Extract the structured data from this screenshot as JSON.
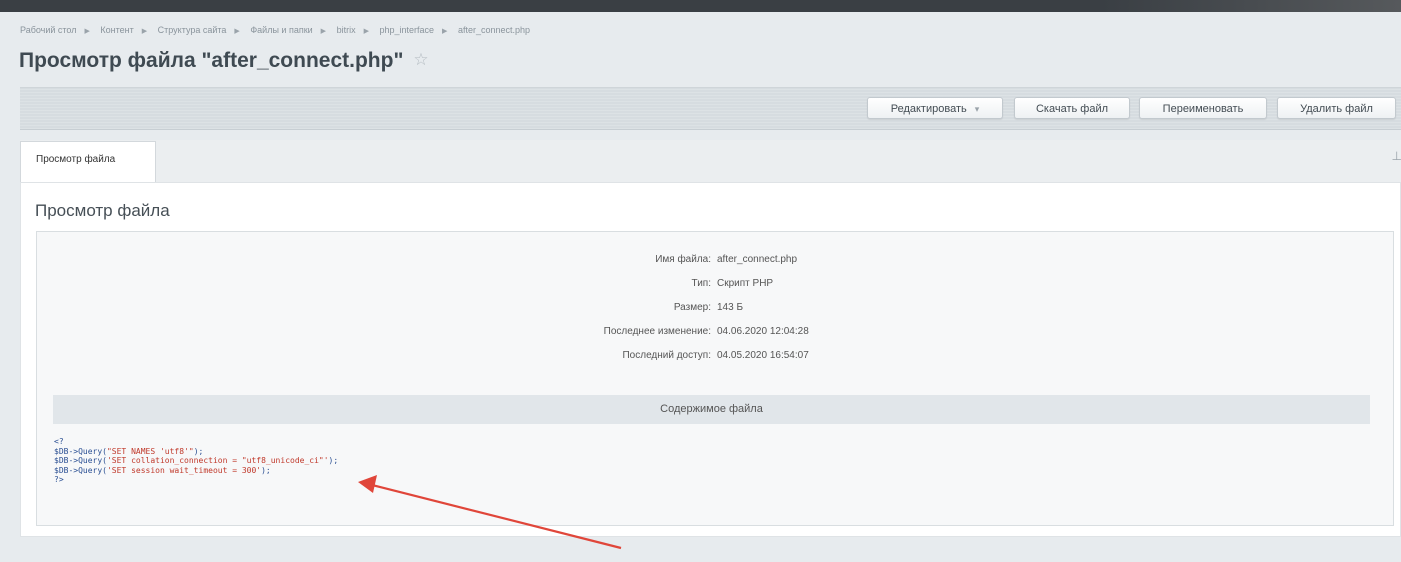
{
  "breadcrumb": [
    "Рабочий стол",
    "Контент",
    "Структура сайта",
    "Файлы и папки",
    "bitrix",
    "php_interface",
    "after_connect.php"
  ],
  "page_title": "Просмотр файла \"after_connect.php\"",
  "toolbar": {
    "edit": "Редактировать",
    "download": "Скачать файл",
    "rename": "Переименовать",
    "delete": "Удалить файл"
  },
  "tab": "Просмотр файла",
  "section_title": "Просмотр файла",
  "props": [
    {
      "label": "Имя файла:",
      "value": "after_connect.php"
    },
    {
      "label": "Тип:",
      "value": "Скрипт PHP"
    },
    {
      "label": "Размер:",
      "value": "143 Б"
    },
    {
      "label": "Последнее изменение:",
      "value": "04.06.2020 12:04:28"
    },
    {
      "label": "Последний доступ:",
      "value": "04.05.2020 16:54:07"
    }
  ],
  "content_header": "Содержимое файла",
  "code": {
    "l0": "<?",
    "l1a": "$DB->Query(",
    "l1b": "\"SET NAMES 'utf8'\"",
    "l1c": ");",
    "l2a": "$DB->Query(",
    "l2b": "'SET collation_connection = \"utf8_unicode_ci\"'",
    "l2c": ");",
    "l3a": "$DB->Query(",
    "l3b": "'SET session wait_timeout = 300'",
    "l3c": ");",
    "l4": "?>"
  },
  "colors": {
    "arrow": "#e0463a",
    "code_keyword": "#2a4f93",
    "code_string": "#c0392b"
  }
}
